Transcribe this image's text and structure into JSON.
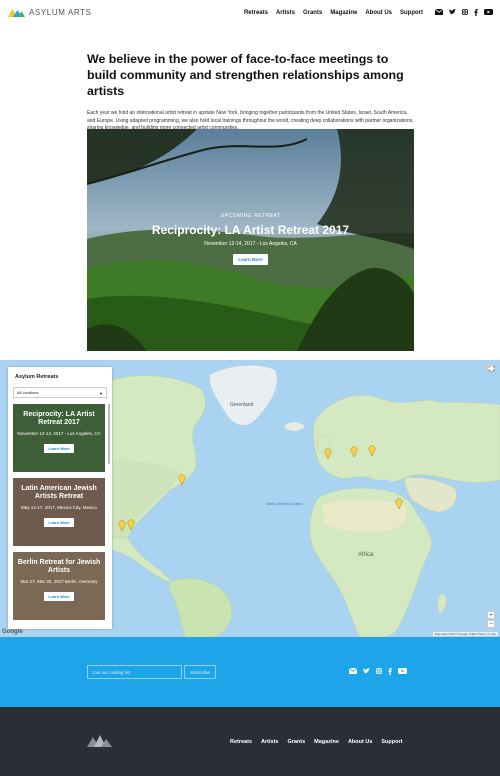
{
  "brand": {
    "name": "ASYLUM ARTS"
  },
  "nav": {
    "items": [
      "Retreats",
      "Artists",
      "Grants",
      "Magazine",
      "About Us",
      "Support"
    ],
    "social": [
      "mail-icon",
      "twitter-icon",
      "instagram-icon",
      "facebook-icon",
      "youtube-icon"
    ]
  },
  "intro": {
    "heading": "We believe in the power of face-to-face meetings to build community and strengthen relationships among artists",
    "body": "Each year we hold an international artist retreat in upstate New York, bringing together participants from the United States, Israel, South America, and Europe. Using adapted programming, we also hold local trainings throughout the world, creating deep collaborations with partner organizations, sharing knowledge, and building more connected artist communities."
  },
  "hero": {
    "kicker": "UPCOMING RETREAT",
    "title": "Reciprocity: LA Artist Retreat 2017",
    "date": "November 12-14, 2017 - Los Angeles, CA",
    "button": "Learn More"
  },
  "retreats_panel": {
    "title": "Asylum Retreats",
    "filter_value": "All locations",
    "cards": [
      {
        "title": "Reciprocity: LA Artist Retreat 2017",
        "date": "November 12-14, 2017 - Los Angeles, CA",
        "button": "Learn More"
      },
      {
        "title": "Latin American Jewish Artists Retreat",
        "date": "May 14-17, 2017, Mexico City, Mexico",
        "button": "Learn More"
      },
      {
        "title": "Berlin Retreat for Jewish Artists",
        "date": "Mar 27- Mar 30, 2017 Berlin, Germany",
        "button": "Learn More"
      }
    ]
  },
  "map": {
    "labels": {
      "greenland": "Greenland",
      "atlantic": "North Atlantic Ocean",
      "africa": "Africa",
      "google": "Google",
      "attribution": "Map data ©2017 Google, INEGI    Terms of Use"
    },
    "zoom_in": "+",
    "zoom_out": "−"
  },
  "newsletter": {
    "placeholder": "Join our mailing list",
    "button": "Subscribe"
  },
  "footer": {
    "nav": [
      "Retreats",
      "Artists",
      "Grants",
      "Magazine",
      "About Us",
      "Support"
    ]
  },
  "colors": {
    "accent": "#1ea4e9",
    "footer": "#2b2e35",
    "ocean": "#a9d3f0",
    "land": "#d4e8c2",
    "marker": "#f3d34a"
  }
}
